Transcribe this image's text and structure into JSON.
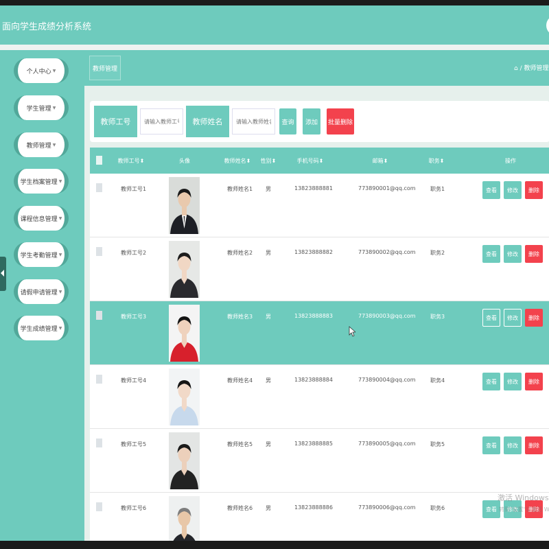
{
  "app": {
    "title": "面向学生成绩分析系统"
  },
  "sidebar": {
    "items": [
      {
        "label": "个人中心"
      },
      {
        "label": "学生管理"
      },
      {
        "label": "教师管理"
      },
      {
        "label": "学生档案管理"
      },
      {
        "label": "课程信息管理"
      },
      {
        "label": "学生考勤管理"
      },
      {
        "label": "请假申请管理"
      },
      {
        "label": "学生成绩管理"
      }
    ]
  },
  "breadcrumb": {
    "tab": "教师管理",
    "path": "⌂ / 教师管理 / 教"
  },
  "search": {
    "id_label": "教师工号",
    "id_placeholder": "请输入教师工号",
    "name_label": "教师姓名",
    "name_placeholder": "请输入教师姓名",
    "query_label": "查询",
    "add_label": "添加",
    "batch_delete_label": "批量删除"
  },
  "table": {
    "columns": [
      "教师工号",
      "头像",
      "教师姓名",
      "性别",
      "手机号码",
      "邮箱",
      "职务",
      "操作"
    ],
    "rows": [
      {
        "id": "教师工号1",
        "name": "教师姓名1",
        "gender": "男",
        "phone": "13823888881",
        "email": "773890001@qq.com",
        "duty": "职务1",
        "selected": false
      },
      {
        "id": "教师工号2",
        "name": "教师姓名2",
        "gender": "男",
        "phone": "13823888882",
        "email": "773890002@qq.com",
        "duty": "职务2",
        "selected": false
      },
      {
        "id": "教师工号3",
        "name": "教师姓名3",
        "gender": "男",
        "phone": "13823888883",
        "email": "773890003@qq.com",
        "duty": "职务3",
        "selected": true
      },
      {
        "id": "教师工号4",
        "name": "教师姓名4",
        "gender": "男",
        "phone": "13823888884",
        "email": "773890004@qq.com",
        "duty": "职务4",
        "selected": false
      },
      {
        "id": "教师工号5",
        "name": "教师姓名5",
        "gender": "男",
        "phone": "13823888885",
        "email": "773890005@qq.com",
        "duty": "职务5",
        "selected": false
      },
      {
        "id": "教师工号6",
        "name": "教师姓名6",
        "gender": "男",
        "phone": "13823888886",
        "email": "773890006@qq.com",
        "duty": "职务6",
        "selected": false
      }
    ],
    "actions": {
      "view": "查看",
      "edit": "修改",
      "delete": "删除"
    }
  },
  "watermark": {
    "line1": "激活 Windows",
    "line2": "转到\"设置\"以激活 Windows。"
  },
  "colors": {
    "accent": "#6ecbbd",
    "danger": "#f3424d"
  }
}
